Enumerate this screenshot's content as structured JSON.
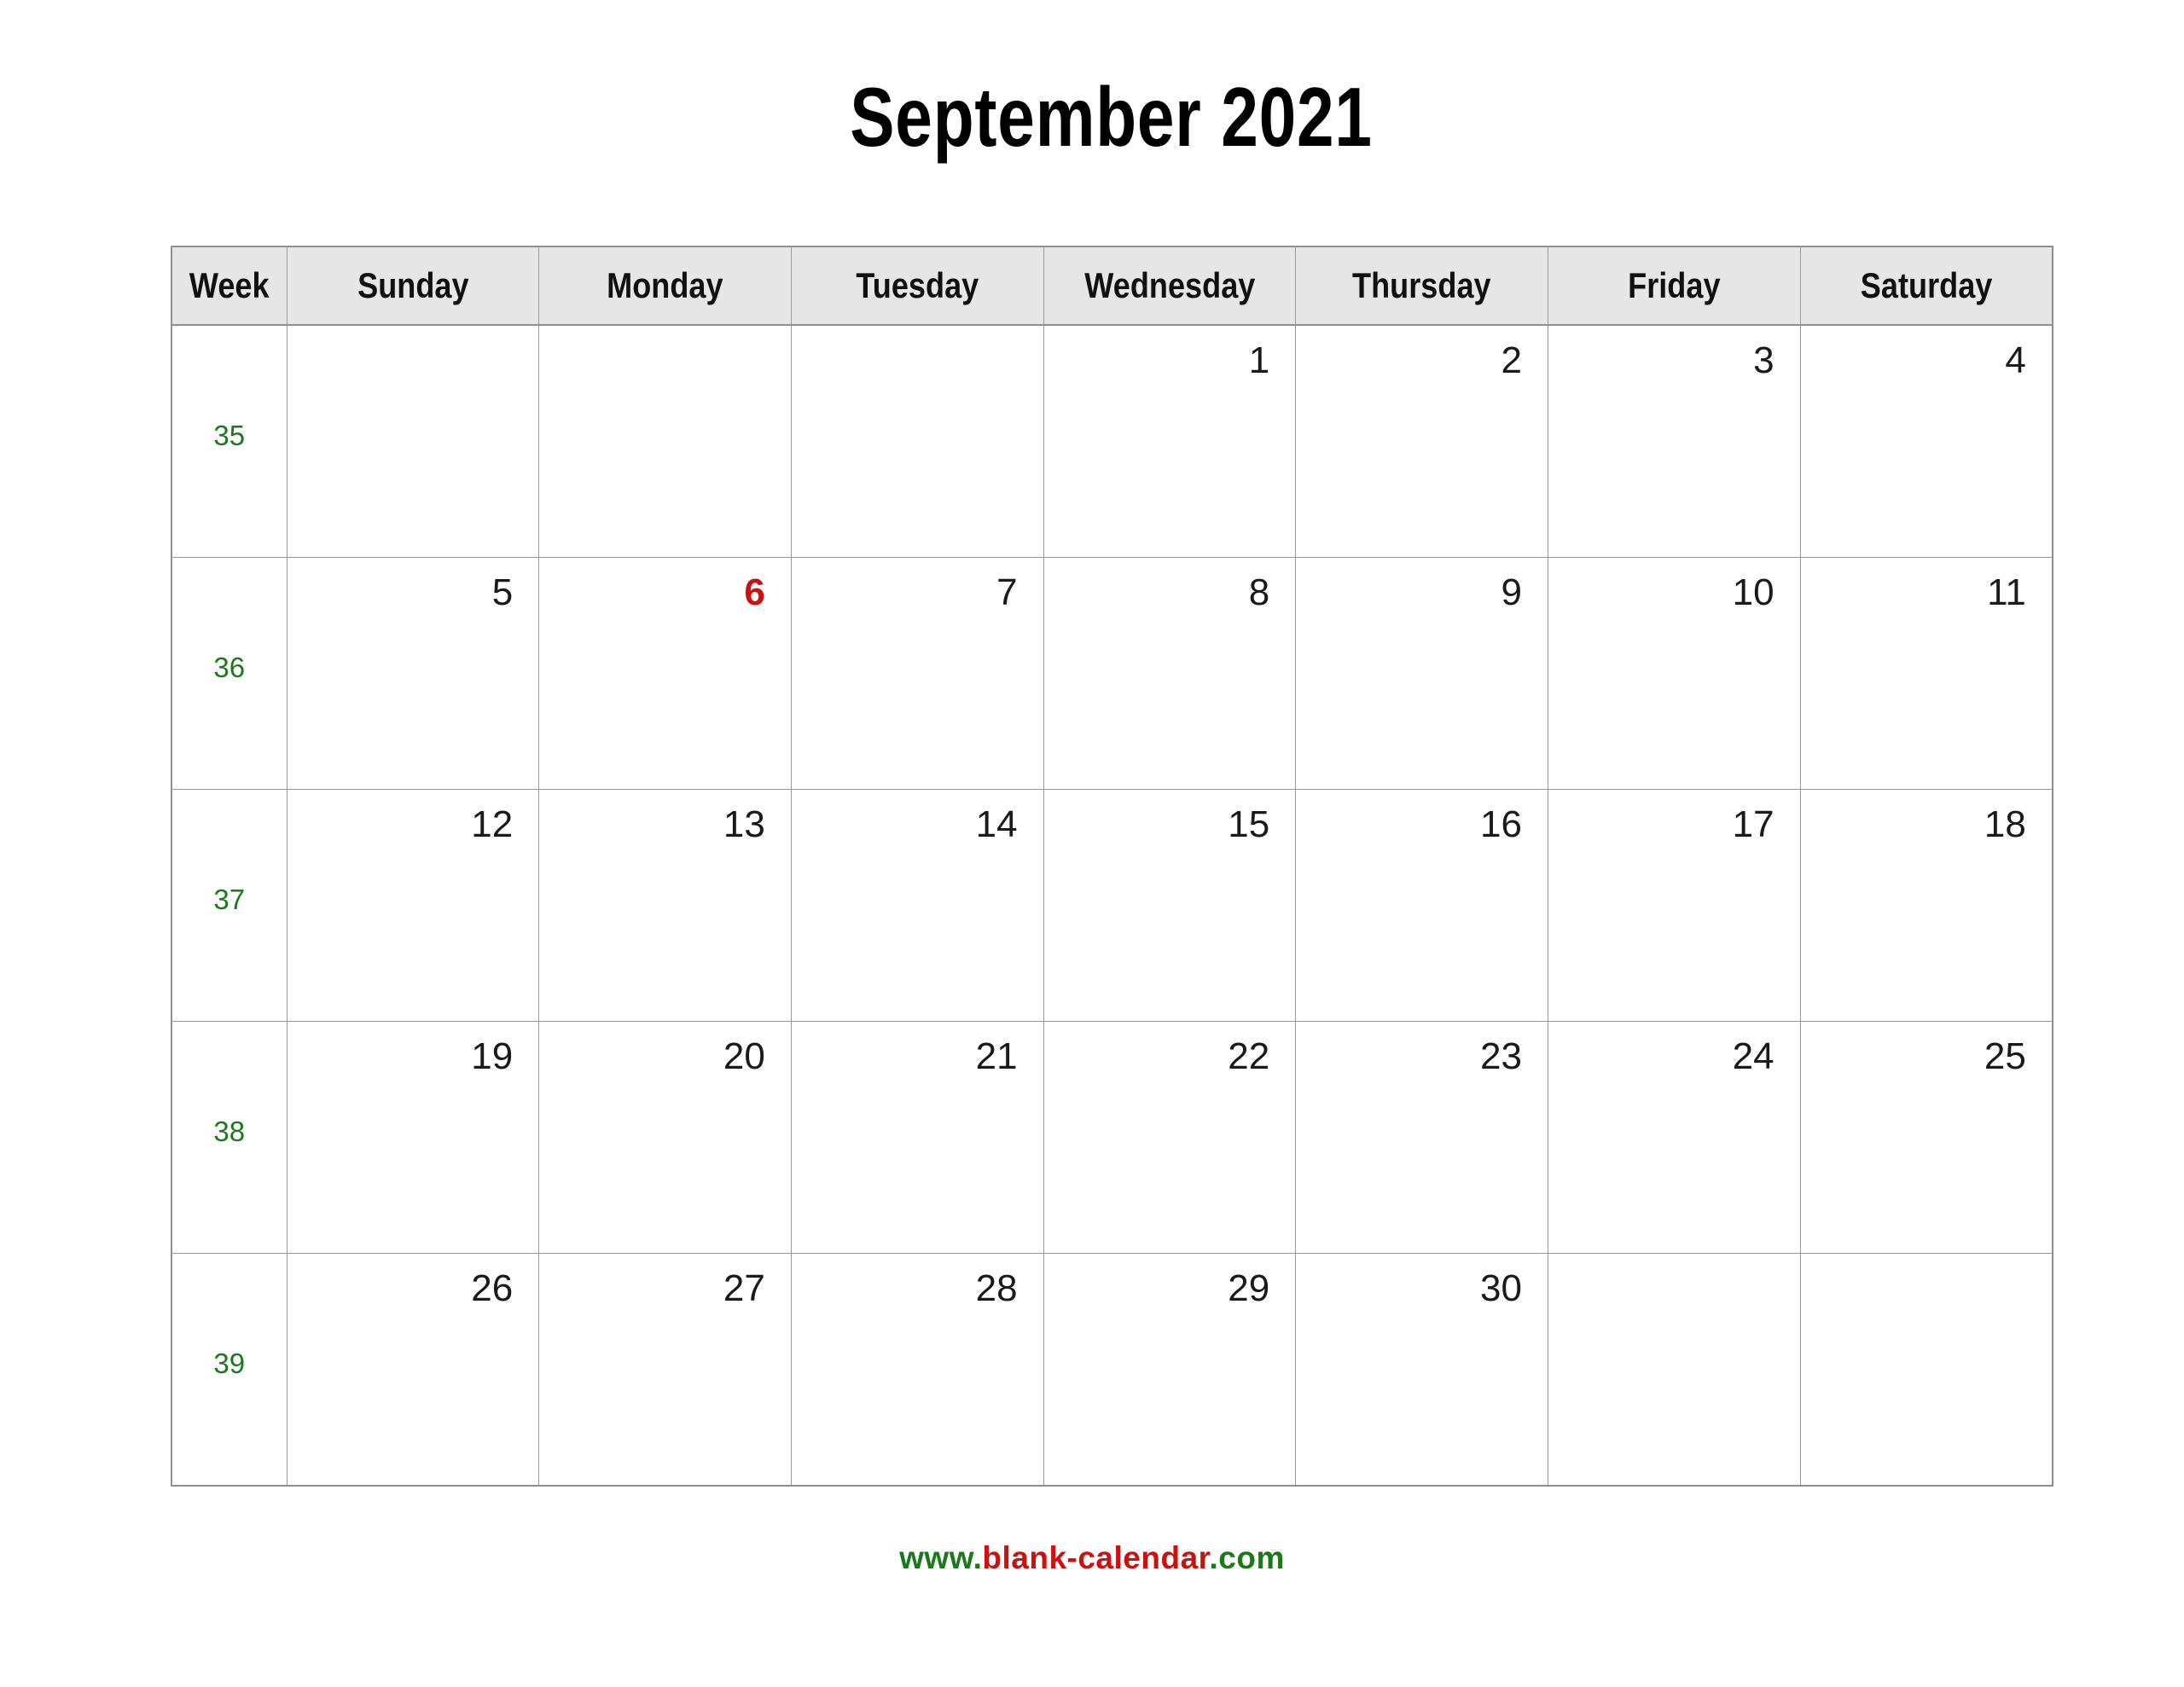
{
  "title": "September 2021",
  "colors": {
    "header_background": "#e6e6e6",
    "border": "#9a9a9a",
    "week_number": "#1a7a1a",
    "holiday_date": "#cc1111",
    "date": "#1a1a1a",
    "footer_green": "#1a7a1a",
    "footer_red": "#cc1111",
    "page_background": "#ffffff"
  },
  "table": {
    "headers": {
      "week": "Week",
      "days": [
        "Sunday",
        "Monday",
        "Tuesday",
        "Wednesday",
        "Thursday",
        "Friday",
        "Saturday"
      ]
    },
    "rows": [
      {
        "week": "35",
        "days": [
          {
            "date": "",
            "holiday": false
          },
          {
            "date": "",
            "holiday": false
          },
          {
            "date": "",
            "holiday": false
          },
          {
            "date": "1",
            "holiday": false
          },
          {
            "date": "2",
            "holiday": false
          },
          {
            "date": "3",
            "holiday": false
          },
          {
            "date": "4",
            "holiday": false
          }
        ]
      },
      {
        "week": "36",
        "days": [
          {
            "date": "5",
            "holiday": false
          },
          {
            "date": "6",
            "holiday": true
          },
          {
            "date": "7",
            "holiday": false
          },
          {
            "date": "8",
            "holiday": false
          },
          {
            "date": "9",
            "holiday": false
          },
          {
            "date": "10",
            "holiday": false
          },
          {
            "date": "11",
            "holiday": false
          }
        ]
      },
      {
        "week": "37",
        "days": [
          {
            "date": "12",
            "holiday": false
          },
          {
            "date": "13",
            "holiday": false
          },
          {
            "date": "14",
            "holiday": false
          },
          {
            "date": "15",
            "holiday": false
          },
          {
            "date": "16",
            "holiday": false
          },
          {
            "date": "17",
            "holiday": false
          },
          {
            "date": "18",
            "holiday": false
          }
        ]
      },
      {
        "week": "38",
        "days": [
          {
            "date": "19",
            "holiday": false
          },
          {
            "date": "20",
            "holiday": false
          },
          {
            "date": "21",
            "holiday": false
          },
          {
            "date": "22",
            "holiday": false
          },
          {
            "date": "23",
            "holiday": false
          },
          {
            "date": "24",
            "holiday": false
          },
          {
            "date": "25",
            "holiday": false
          }
        ]
      },
      {
        "week": "39",
        "days": [
          {
            "date": "26",
            "holiday": false
          },
          {
            "date": "27",
            "holiday": false
          },
          {
            "date": "28",
            "holiday": false
          },
          {
            "date": "29",
            "holiday": false
          },
          {
            "date": "30",
            "holiday": false
          },
          {
            "date": "",
            "holiday": false
          },
          {
            "date": "",
            "holiday": false
          }
        ]
      }
    ]
  },
  "footer": {
    "prefix": "www.",
    "name": "blank-calendar",
    "suffix": ".com"
  }
}
